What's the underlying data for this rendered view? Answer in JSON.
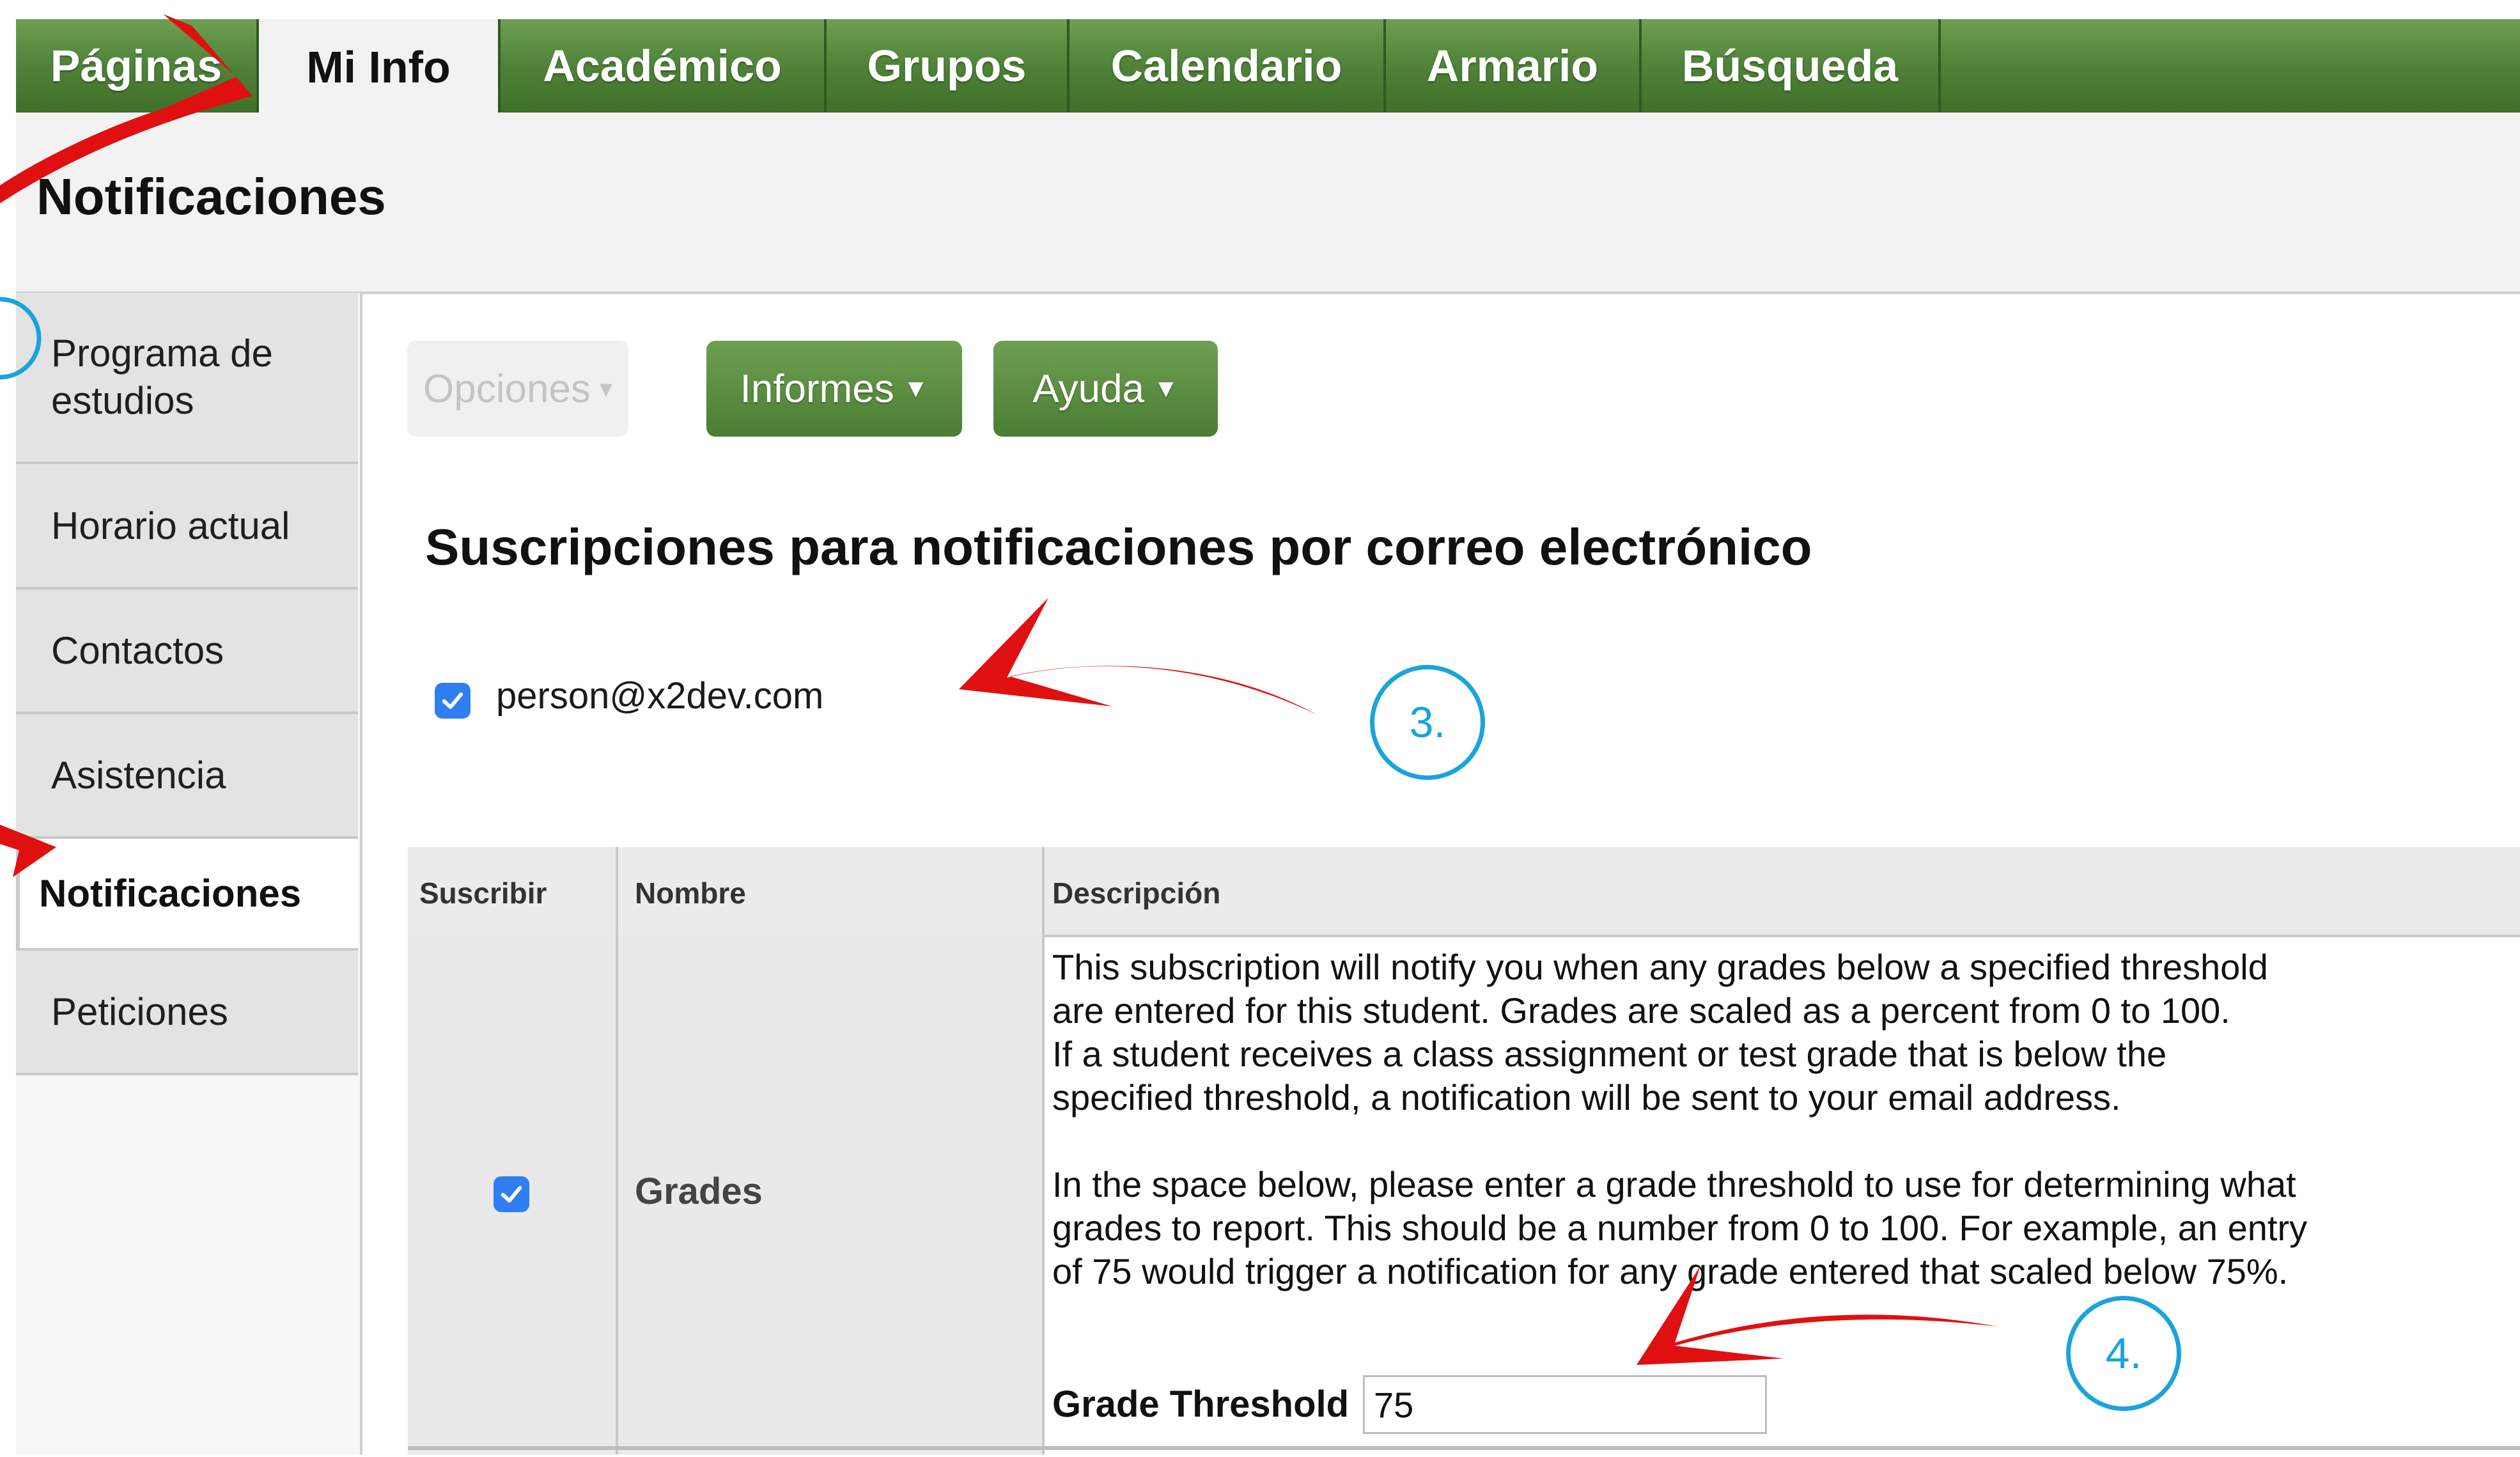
{
  "nav": {
    "tabs": [
      {
        "label": "Páginas"
      },
      {
        "label": "Mi Info"
      },
      {
        "label": "Académico"
      },
      {
        "label": "Grupos"
      },
      {
        "label": "Calendario"
      },
      {
        "label": "Armario"
      },
      {
        "label": "Búsqueda"
      }
    ],
    "active_tab": "Mi Info"
  },
  "page": {
    "title": "Notificaciones"
  },
  "sidebar": {
    "items": [
      {
        "label_line1": "Programa de",
        "label_line2": "estudios"
      },
      {
        "label": "Horario actual"
      },
      {
        "label": "Contactos"
      },
      {
        "label": "Asistencia"
      },
      {
        "label": "Notificaciones"
      },
      {
        "label": "Peticiones"
      }
    ],
    "active_item": "Notificaciones"
  },
  "toolbar": {
    "options_label": "Opciones",
    "reports_label": "Informes",
    "help_label": "Ayuda"
  },
  "subscriptions": {
    "title": "Suscripciones para notificaciones por correo electrónico",
    "email": "person@x2dev.com",
    "email_checked": true
  },
  "table": {
    "headers": {
      "subscribe": "Suscribir",
      "name": "Nombre",
      "description": "Descripción"
    },
    "rows": [
      {
        "checked": true,
        "name": "Grades",
        "description_lines": [
          "This subscription will notify you when any grades below a specified threshold",
          "are entered for this student. Grades are scaled as a percent from 0 to 100.",
          "If a student receives a class assignment or test grade that is below the",
          "specified threshold, a notification will be sent to your email address.",
          "",
          "In the space below, please enter a grade threshold to use for determining what",
          "grades to report. This should be a number from 0 to 100. For example, an entry",
          "of 75 would trigger a notification for any grade entered that scaled below 75%."
        ],
        "threshold_label": "Grade Threshold",
        "threshold_value": "75"
      }
    ]
  },
  "annotations": {
    "step3": "3.",
    "step4": "4.",
    "arrow_color": "#e01010",
    "circle_color": "#1aa3dd"
  },
  "colors": {
    "nav_green": "#4f8338",
    "checkbox_blue": "#2f7ff2"
  }
}
